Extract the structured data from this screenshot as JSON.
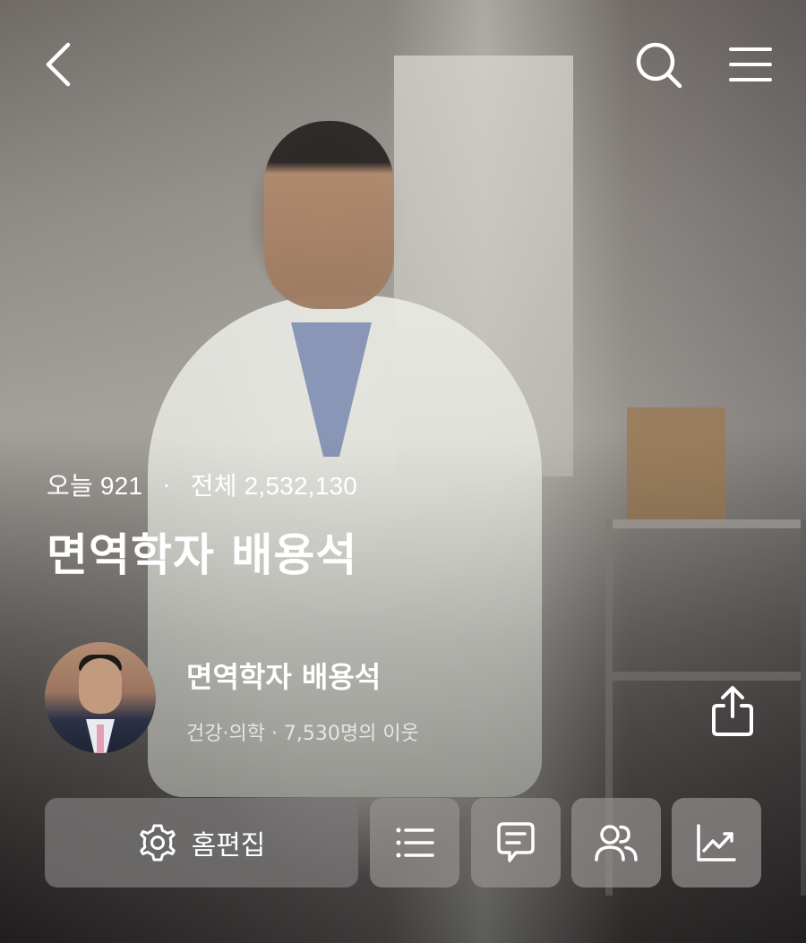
{
  "topbar": {
    "back_icon": "chevron-left-icon",
    "search_icon": "search-icon",
    "menu_icon": "hamburger-menu-icon"
  },
  "stats": {
    "today_label": "오늘 921",
    "separator": "·",
    "total_label": "전체 2,532,130"
  },
  "blog": {
    "title": "면역학자 배용석",
    "author_name": "면역학자 배용석",
    "meta": "건강·의학 · 7,530명의 이웃",
    "avatar_icon": "profile-avatar"
  },
  "actions": {
    "home_edit_label": "홈편집",
    "home_edit_icon": "gear-icon",
    "buttons": [
      {
        "icon": "list-icon"
      },
      {
        "icon": "comment-icon"
      },
      {
        "icon": "people-icon"
      },
      {
        "icon": "trend-chart-icon"
      }
    ],
    "share_icon": "share-icon"
  },
  "colors": {
    "text": "#ffffff",
    "button_bg": "#7a7676"
  }
}
